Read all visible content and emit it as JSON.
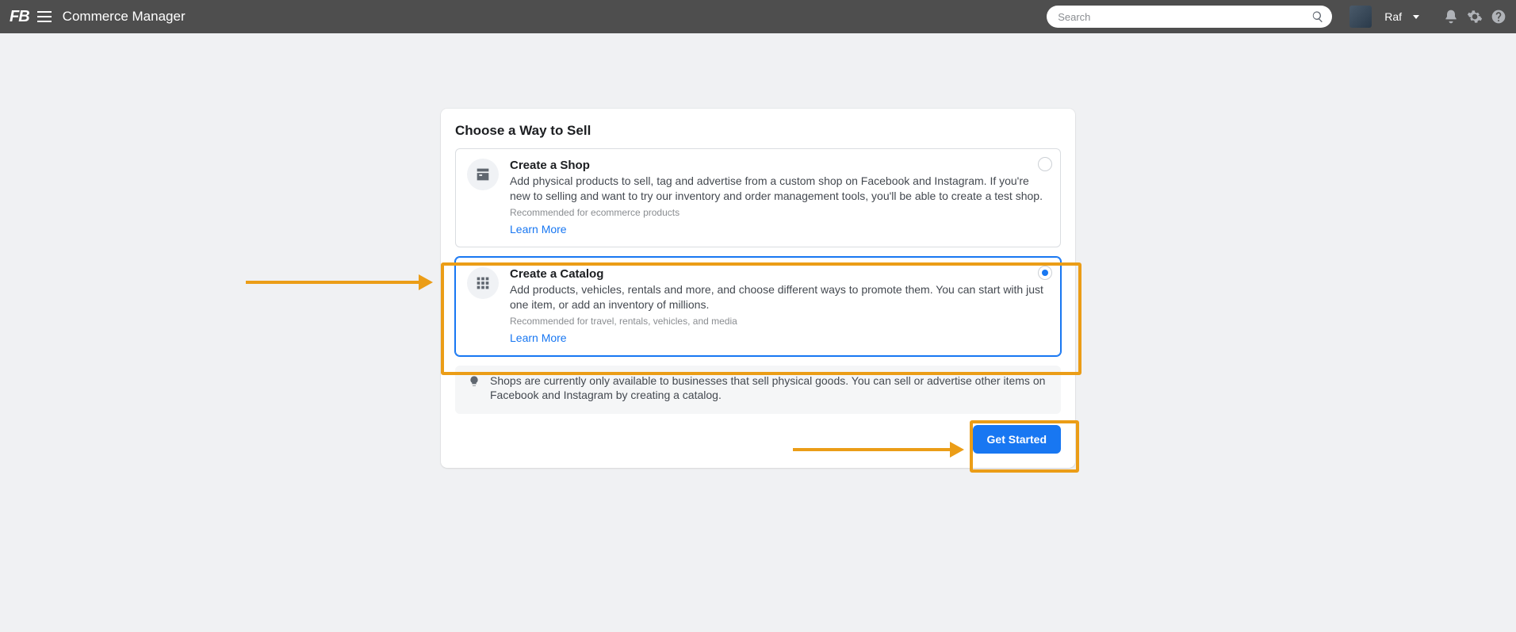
{
  "header": {
    "logo_text": "FB",
    "app_title": "Commerce Manager",
    "search_placeholder": "Search",
    "username": "Raf"
  },
  "card": {
    "title": "Choose a Way to Sell",
    "options": [
      {
        "title": "Create a Shop",
        "description": "Add physical products to sell, tag and advertise from a custom shop on Facebook and Instagram. If you're new to selling and want to try our inventory and order management tools, you'll be able to create a test shop.",
        "recommended": "Recommended for ecommerce products",
        "learn_more": "Learn More",
        "selected": false
      },
      {
        "title": "Create a Catalog",
        "description": "Add products, vehicles, rentals and more, and choose different ways to promote them. You can start with just one item, or add an inventory of millions.",
        "recommended": "Recommended for travel, rentals, vehicles, and media",
        "learn_more": "Learn More",
        "selected": true
      }
    ],
    "info_text": "Shops are currently only available to businesses that sell physical goods. You can sell or advertise other items on Facebook and Instagram by creating a catalog.",
    "button_label": "Get Started"
  }
}
